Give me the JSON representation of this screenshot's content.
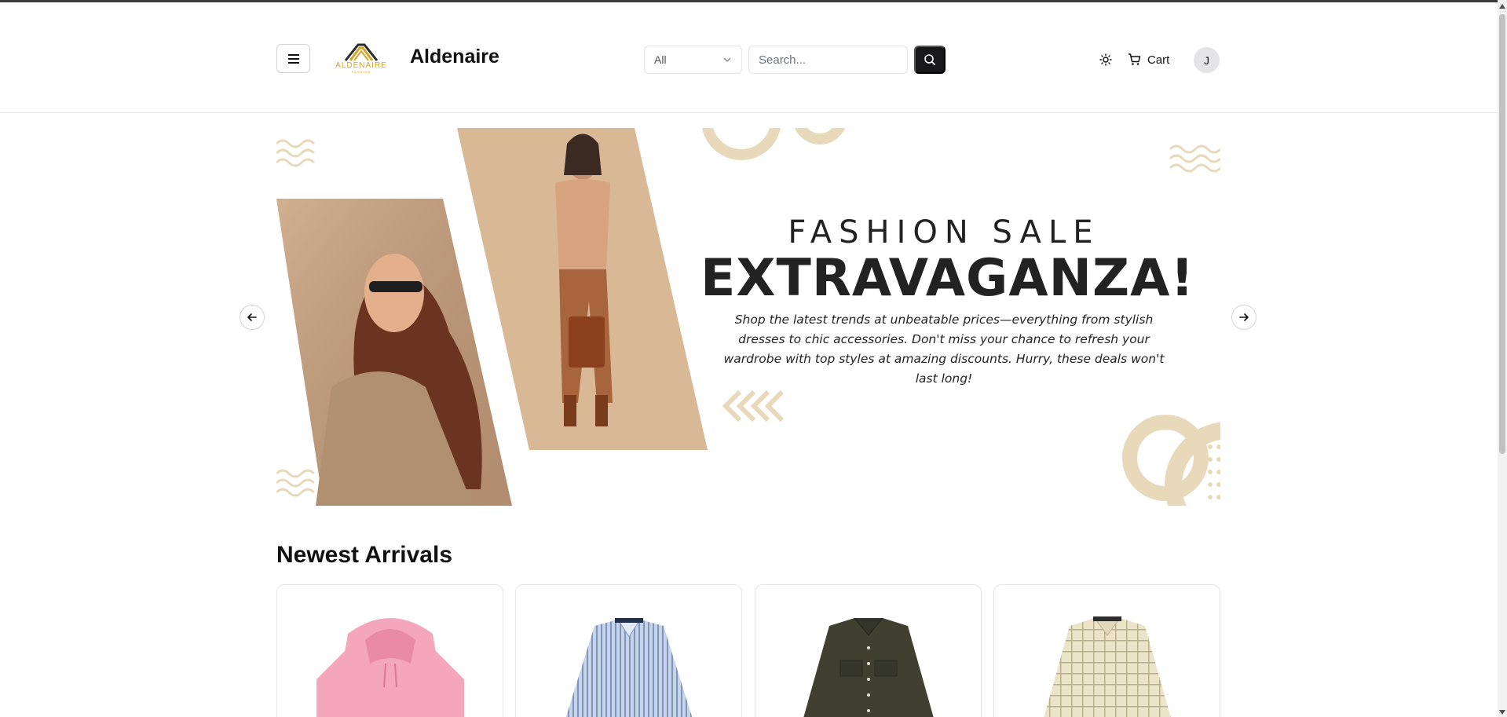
{
  "header": {
    "brand_name": "Aldenaire",
    "logo_text": "ALDENAIRE",
    "logo_subtext": "FASHION",
    "category_select": {
      "selected": "All"
    },
    "search": {
      "placeholder": "Search..."
    },
    "cart_label": "Cart",
    "avatar_initial": "J"
  },
  "hero": {
    "subtitle": "FASHION SALE",
    "title": "EXTRAVAGANZA!",
    "description": "Shop the latest trends at unbeatable prices—everything from stylish dresses to chic accessories. Don't miss your chance to refresh your wardrobe with top styles at amazing discounts. Hurry, these deals won't last long!"
  },
  "newest_arrivals": {
    "title": "Newest Arrivals",
    "products": [
      {
        "name": "pink-hoodie",
        "color": "#f4a6bd"
      },
      {
        "name": "blue-striped-shirt",
        "color": "#a9bedb"
      },
      {
        "name": "olive-shirt",
        "color": "#3f4030"
      },
      {
        "name": "beige-check-shirt",
        "color": "#ece4c9"
      }
    ]
  },
  "colors": {
    "accent_dark": "#18181b",
    "hero_tan": "#e8d9bb",
    "hero_photo_bg": "#d9b896",
    "logo_gold": "#d4a52a"
  }
}
